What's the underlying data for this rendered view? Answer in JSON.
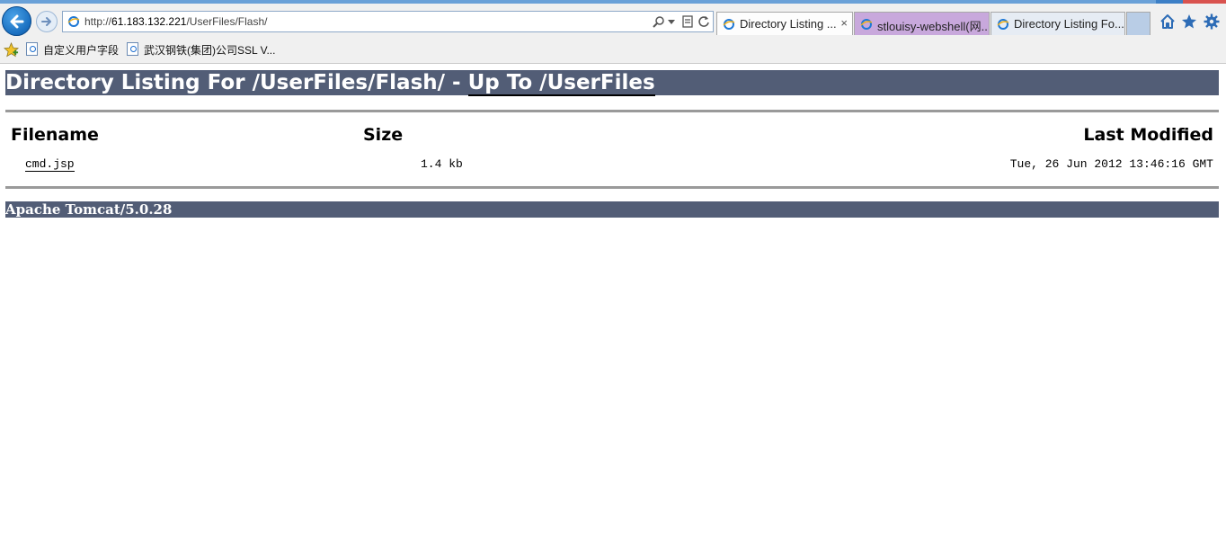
{
  "browser": {
    "address_bar": {
      "url_prefix": "http://",
      "url_host": "61.183.132.221",
      "url_path": "/UserFiles/Flash/"
    },
    "tabs": [
      {
        "title": "Directory Listing ...",
        "active": true,
        "close_glyph": "×"
      },
      {
        "title": "stlouisy-webshell(网...",
        "active": false
      },
      {
        "title": "Directory Listing Fo...",
        "active": false
      }
    ],
    "favorites": [
      {
        "label": "自定义用户字段",
        "icon": "page-icon"
      },
      {
        "label": "武汉钢铁(集团)公司SSL V...",
        "icon": "page-icon"
      }
    ],
    "toolbar_icons": [
      "home-icon",
      "star-icon",
      "gear-icon"
    ]
  },
  "page": {
    "heading_prefix": "Directory Listing For /UserFiles/Flash/ - ",
    "heading_link": "Up To /UserFiles",
    "columns": {
      "name": "Filename",
      "size": "Size",
      "modified": "Last Modified"
    },
    "files": [
      {
        "name": "cmd.jsp",
        "size": "1.4 kb",
        "modified": "Tue, 26 Jun 2012 13:46:16 GMT"
      }
    ],
    "footer": "Apache Tomcat/5.0.28",
    "colors": {
      "bar": "#525d76",
      "rule": "#9a9a9a"
    }
  }
}
